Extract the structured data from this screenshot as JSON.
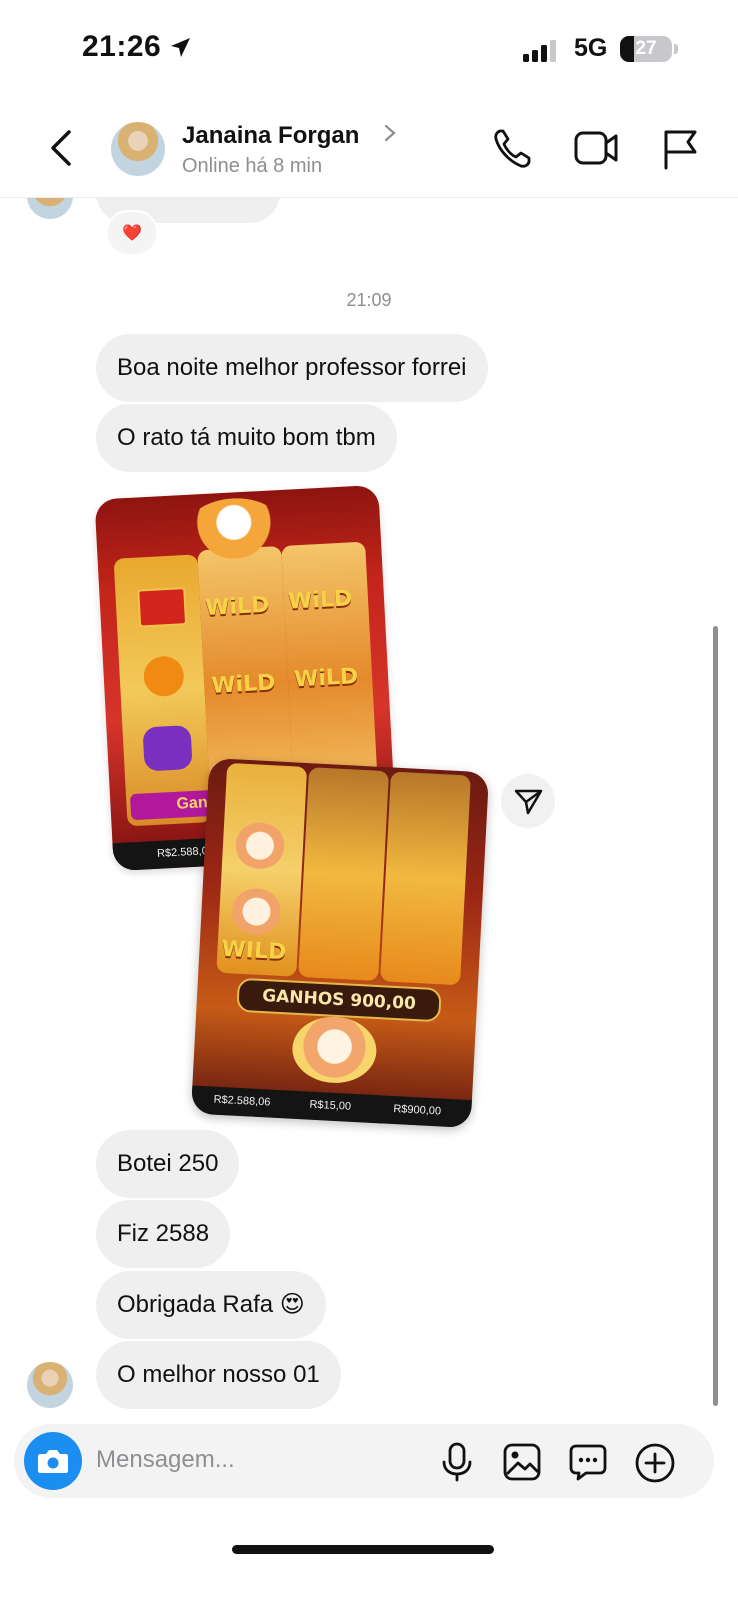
{
  "status_bar": {
    "time": "21:26",
    "network": "5G",
    "battery_level": "27",
    "icons": [
      "location-arrow-icon",
      "signal-bars-icon",
      "battery-icon"
    ]
  },
  "header": {
    "contact_name": "Janaina Forgan",
    "presence": "Online há 8 min",
    "icons": [
      "back-chevron-icon",
      "chevron-right-icon",
      "phone-icon",
      "video-camera-icon",
      "flag-icon"
    ]
  },
  "conversation": {
    "reaction": "❤️",
    "timestamp": "21:09",
    "messages_before_images": [
      "Boa noite melhor professor forrei",
      "O rato tá muito bom tbm"
    ],
    "image_1": {
      "wild_labels": [
        "WiLD",
        "WiLD",
        "WiLD",
        "WiLD"
      ],
      "balance": "R$2.588,06",
      "partial_label": "Ganh"
    },
    "image_2": {
      "win_banner": "GANHOS 900,00",
      "wild_label": "WILD",
      "balance": "R$2.588,06",
      "bet": "R$15,00",
      "win": "R$900,00"
    },
    "messages_after_images": [
      "Botei 250",
      "Fiz 2588",
      "Obrigada Rafa 😍",
      "O melhor nosso 01"
    ]
  },
  "composer": {
    "placeholder": "Mensagem...",
    "icons": [
      "camera-icon",
      "microphone-icon",
      "gallery-icon",
      "sticker-chat-icon",
      "plus-circle-icon"
    ]
  },
  "colors": {
    "bubble": "#efefef",
    "camera_button": "#1b8ef2",
    "muted_text": "#8e8e93"
  }
}
